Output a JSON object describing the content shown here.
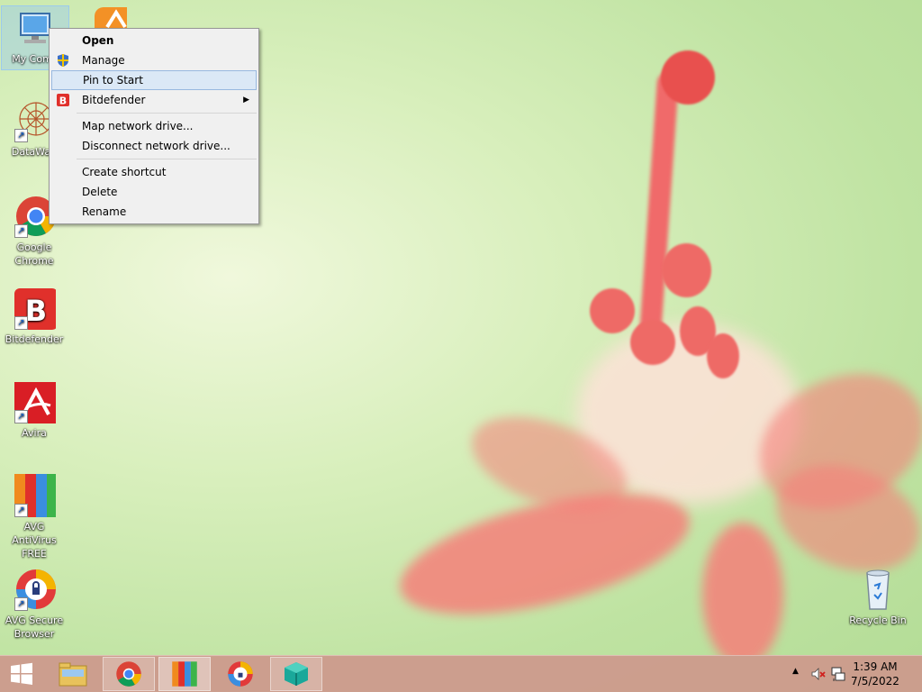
{
  "desktop": {
    "icons": [
      {
        "label": "My Comp",
        "name": "my-computer"
      },
      {
        "label": "DataWag",
        "name": "datawagon"
      },
      {
        "label": "Google Chrome",
        "line1": "Google",
        "line2": "Chrome"
      },
      {
        "label": "Bitdefender"
      },
      {
        "label": "Avira"
      },
      {
        "line1": "AVG AntiVirus",
        "line2": "FREE"
      },
      {
        "line1": "AVG Secure",
        "line2": "Browser"
      },
      {
        "label": "Recycle Bin"
      }
    ]
  },
  "context_menu": {
    "items": [
      {
        "label": "Open",
        "bold": true
      },
      {
        "label": "Manage"
      },
      {
        "label": "Pin to Start",
        "highlighted": true
      },
      {
        "label": "Bitdefender",
        "submenu": true
      },
      {
        "label": "Map network drive..."
      },
      {
        "label": "Disconnect network drive..."
      },
      {
        "label": "Create shortcut"
      },
      {
        "label": "Delete"
      },
      {
        "label": "Rename"
      }
    ]
  },
  "taskbar": {
    "clock_time": "1:39 AM",
    "clock_date": "7/5/2022",
    "tray_arrow": "▲"
  },
  "colors": {
    "accent_red": "#e0302b",
    "taskbar": "#cd988c",
    "menu_highlight": "#dbe8f6"
  }
}
